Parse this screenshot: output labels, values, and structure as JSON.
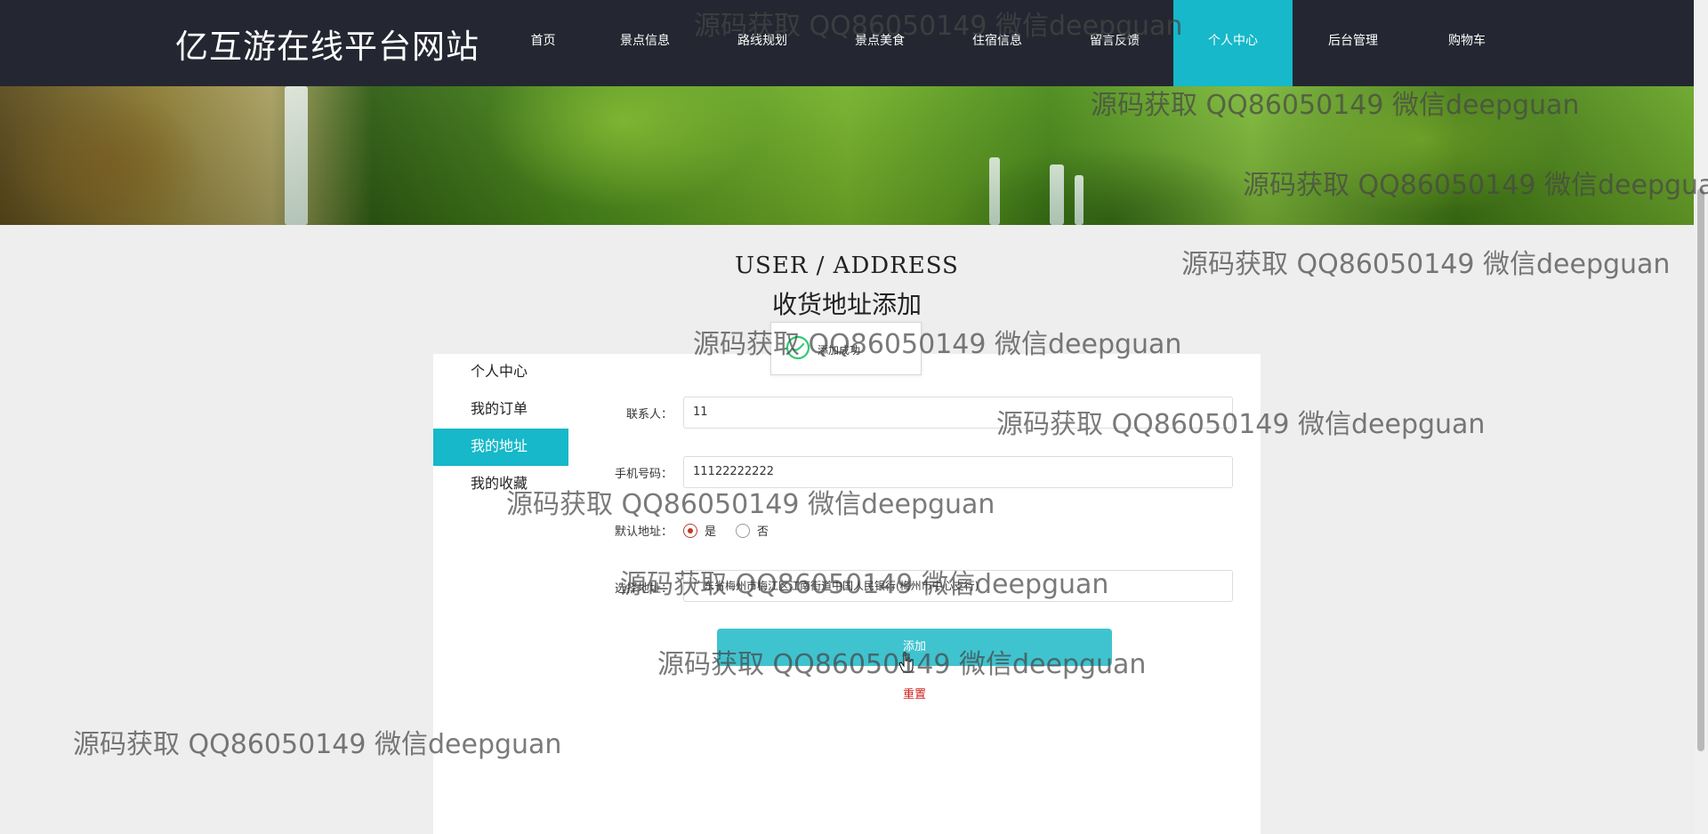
{
  "header": {
    "site_title": "亿互游在线平台网站",
    "nav": [
      {
        "label": "首页"
      },
      {
        "label": "景点信息"
      },
      {
        "label": "路线规划"
      },
      {
        "label": "景点美食"
      },
      {
        "label": "住宿信息"
      },
      {
        "label": "留言反馈"
      },
      {
        "label": "个人中心",
        "active": true
      },
      {
        "label": "后台管理"
      },
      {
        "label": "购物车"
      }
    ]
  },
  "section": {
    "title_en": "USER / ADDRESS",
    "title_cn": "收货地址添加"
  },
  "sidebar": {
    "items": [
      {
        "label": "个人中心"
      },
      {
        "label": "我的订单"
      },
      {
        "label": "我的地址",
        "active": true
      },
      {
        "label": "我的收藏"
      }
    ]
  },
  "form": {
    "contact_label": "联系人：",
    "contact_value": "11",
    "phone_label": "手机号码：",
    "phone_value": "11122222222",
    "default_label": "默认地址：",
    "default_yes": "是",
    "default_no": "否",
    "default_selected": "是",
    "address_label": "选择地址：",
    "address_value": "广东省梅州市梅江区江南街道中国人民银行(梅州市中心支行)",
    "submit_label": "添加",
    "reset_label": "重置"
  },
  "toast": {
    "message": "添加成功",
    "icon": "success-circle-icon"
  },
  "watermark": {
    "text": "源码获取 QQ86050149 微信deepguan"
  },
  "colors": {
    "header_bg": "#242731",
    "accent": "#16b8c9",
    "button": "#3fc3cf",
    "reset": "#d02020"
  }
}
